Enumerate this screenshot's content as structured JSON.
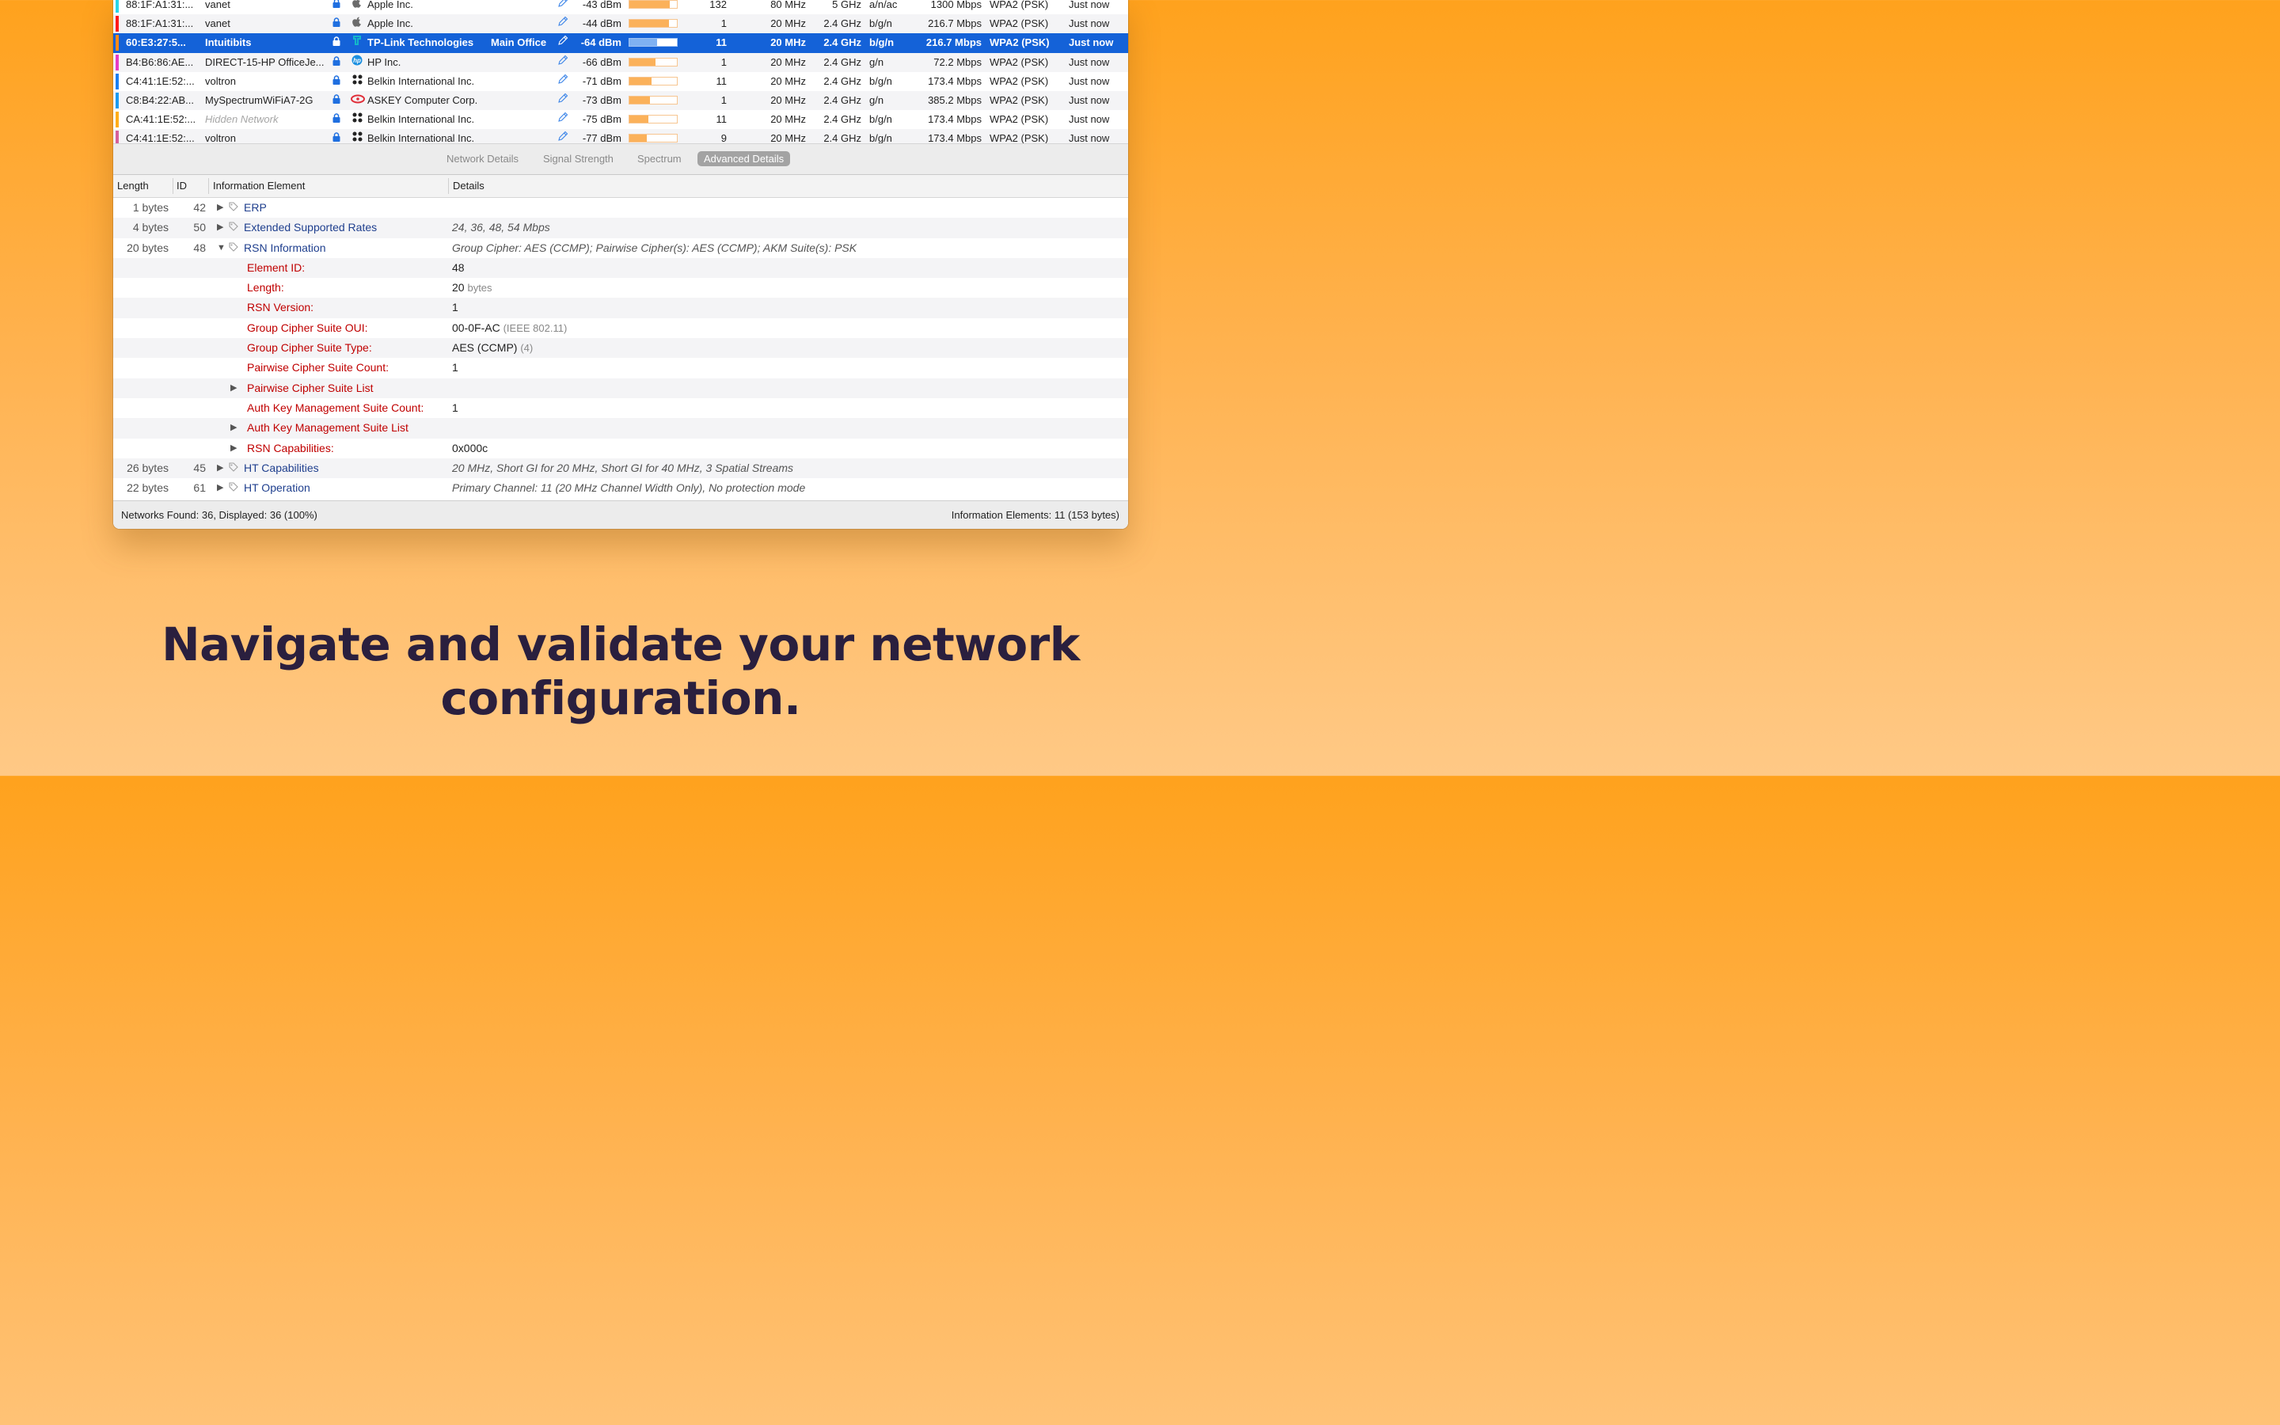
{
  "networks": [
    {
      "color": "#2ad6e8",
      "bssid": "88:1F:A1:31:...",
      "ssid": "vanet",
      "hidden": false,
      "vendor_icon": "apple-icon",
      "vendor": "Apple Inc.",
      "location": "",
      "signal": "-43 dBm",
      "signal_level": 0.85,
      "channel": "132",
      "width": "80 MHz",
      "band": "5 GHz",
      "mode": "a/n/ac",
      "rate": "1300 Mbps",
      "security": "WPA2 (PSK)",
      "last_seen": "Just now",
      "selected": false
    },
    {
      "color": "#ff1a1a",
      "bssid": "88:1F:A1:31:...",
      "ssid": "vanet",
      "hidden": false,
      "vendor_icon": "apple-icon",
      "vendor": "Apple Inc.",
      "location": "",
      "signal": "-44 dBm",
      "signal_level": 0.83,
      "channel": "1",
      "width": "20 MHz",
      "band": "2.4 GHz",
      "mode": "b/g/n",
      "rate": "216.7 Mbps",
      "security": "WPA2 (PSK)",
      "last_seen": "Just now",
      "selected": false
    },
    {
      "color": "#ff8a1a",
      "bssid": "60:E3:27:5...",
      "ssid": "Intuitibits",
      "hidden": false,
      "vendor_icon": "tplink-icon",
      "vendor": "TP-Link Technologies",
      "location": "Main Office",
      "signal": "-64 dBm",
      "signal_level": 0.58,
      "channel": "11",
      "width": "20 MHz",
      "band": "2.4 GHz",
      "mode": "b/g/n",
      "rate": "216.7 Mbps",
      "security": "WPA2 (PSK)",
      "last_seen": "Just now",
      "selected": true
    },
    {
      "color": "#e63cc4",
      "bssid": "B4:B6:86:AE...",
      "ssid": "DIRECT-15-HP OfficeJe...",
      "hidden": false,
      "vendor_icon": "hp-icon",
      "vendor": "HP Inc.",
      "location": "",
      "signal": "-66 dBm",
      "signal_level": 0.55,
      "channel": "1",
      "width": "20 MHz",
      "band": "2.4 GHz",
      "mode": "g/n",
      "rate": "72.2 Mbps",
      "security": "WPA2 (PSK)",
      "last_seen": "Just now",
      "selected": false
    },
    {
      "color": "#1a7ff0",
      "bssid": "C4:41:1E:52:...",
      "ssid": "voltron",
      "hidden": false,
      "vendor_icon": "belkin-icon",
      "vendor": "Belkin International Inc.",
      "location": "",
      "signal": "-71 dBm",
      "signal_level": 0.46,
      "channel": "11",
      "width": "20 MHz",
      "band": "2.4 GHz",
      "mode": "b/g/n",
      "rate": "173.4 Mbps",
      "security": "WPA2 (PSK)",
      "last_seen": "Just now",
      "selected": false
    },
    {
      "color": "#1a9bf0",
      "bssid": "C8:B4:22:AB...",
      "ssid": "MySpectrumWiFiA7-2G",
      "hidden": false,
      "vendor_icon": "askey-icon",
      "vendor": "ASKEY Computer Corp.",
      "location": "",
      "signal": "-73 dBm",
      "signal_level": 0.43,
      "channel": "1",
      "width": "20 MHz",
      "band": "2.4 GHz",
      "mode": "g/n",
      "rate": "385.2 Mbps",
      "security": "WPA2 (PSK)",
      "last_seen": "Just now",
      "selected": false
    },
    {
      "color": "#ffae1a",
      "bssid": "CA:41:1E:52:...",
      "ssid": "Hidden Network",
      "hidden": true,
      "vendor_icon": "belkin-icon",
      "vendor": "Belkin International Inc.",
      "location": "",
      "signal": "-75 dBm",
      "signal_level": 0.4,
      "channel": "11",
      "width": "20 MHz",
      "band": "2.4 GHz",
      "mode": "b/g/n",
      "rate": "173.4 Mbps",
      "security": "WPA2 (PSK)",
      "last_seen": "Just now",
      "selected": false
    },
    {
      "color": "#d6609a",
      "bssid": "C4:41:1E:52:...",
      "ssid": "voltron",
      "hidden": false,
      "vendor_icon": "belkin-icon",
      "vendor": "Belkin International Inc.",
      "location": "",
      "signal": "-77 dBm",
      "signal_level": 0.37,
      "channel": "9",
      "width": "20 MHz",
      "band": "2.4 GHz",
      "mode": "b/g/n",
      "rate": "173.4 Mbps",
      "security": "WPA2 (PSK)",
      "last_seen": "Just now",
      "selected": false
    }
  ],
  "tabs": [
    {
      "label": "Network Details",
      "active": false
    },
    {
      "label": "Signal Strength",
      "active": false
    },
    {
      "label": "Spectrum",
      "active": false
    },
    {
      "label": "Advanced Details",
      "active": true
    }
  ],
  "ie_columns": {
    "length": "Length",
    "id": "ID",
    "element": "Information Element",
    "details": "Details"
  },
  "ie_rows": [
    {
      "type": "element",
      "length": "1 bytes",
      "id": "42",
      "disclosure": "collapsed",
      "name": "ERP",
      "details": ""
    },
    {
      "type": "element",
      "length": "4 bytes",
      "id": "50",
      "disclosure": "collapsed",
      "name": "Extended Supported Rates",
      "details": "24, 36, 48, 54 Mbps"
    },
    {
      "type": "element",
      "length": "20 bytes",
      "id": "48",
      "disclosure": "expanded",
      "name": "RSN Information",
      "details": "Group Cipher: AES (CCMP); Pairwise Cipher(s): AES (CCMP); AKM Suite(s): PSK"
    },
    {
      "type": "field",
      "disclosure": "none",
      "name": "Element ID:",
      "value": "48",
      "suffix": ""
    },
    {
      "type": "field",
      "disclosure": "none",
      "name": "Length:",
      "value": "20",
      "suffix": "bytes"
    },
    {
      "type": "field",
      "disclosure": "none",
      "name": "RSN Version:",
      "value": "1",
      "suffix": ""
    },
    {
      "type": "field",
      "disclosure": "none",
      "name": "Group Cipher Suite OUI:",
      "value": "00-0F-AC",
      "suffix": "(IEEE 802.11)"
    },
    {
      "type": "field",
      "disclosure": "none",
      "name": "Group Cipher Suite Type:",
      "value": "AES (CCMP)",
      "suffix": "(4)"
    },
    {
      "type": "field",
      "disclosure": "none",
      "name": "Pairwise Cipher Suite Count:",
      "value": "1",
      "suffix": ""
    },
    {
      "type": "field",
      "disclosure": "collapsed",
      "name": "Pairwise Cipher Suite List",
      "value": "",
      "suffix": ""
    },
    {
      "type": "field",
      "disclosure": "none",
      "name": "Auth Key Management Suite Count:",
      "value": "1",
      "suffix": ""
    },
    {
      "type": "field",
      "disclosure": "collapsed",
      "name": "Auth Key Management Suite List",
      "value": "",
      "suffix": ""
    },
    {
      "type": "field",
      "disclosure": "collapsed",
      "name": "RSN Capabilities:",
      "value": "0x000c",
      "suffix": ""
    },
    {
      "type": "element",
      "length": "26 bytes",
      "id": "45",
      "disclosure": "collapsed",
      "name": "HT Capabilities",
      "details": "20 MHz, Short GI for 20 MHz, Short GI for 40 MHz, 3 Spatial Streams"
    },
    {
      "type": "element",
      "length": "22 bytes",
      "id": "61",
      "disclosure": "collapsed",
      "name": "HT Operation",
      "details": "Primary Channel: 11 (20 MHz Channel Width Only), No protection mode"
    }
  ],
  "status": {
    "left": "Networks Found: 36, Displayed: 36 (100%)",
    "right": "Information Elements: 11 (153 bytes)"
  },
  "tagline": "Navigate and validate your network configuration.",
  "colors": {
    "selection": "#1462d8",
    "field_name": "#c00000",
    "element_name": "#1f3f8e",
    "signal_fill": "#fbb15a",
    "tagline": "#2a1f3e"
  }
}
